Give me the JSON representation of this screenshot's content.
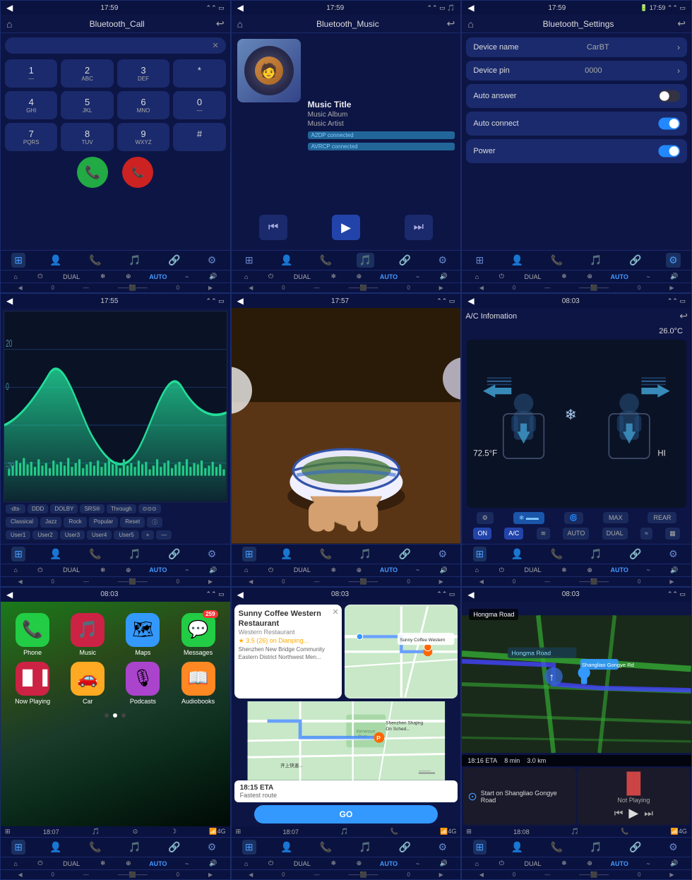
{
  "panels": [
    {
      "id": "bluetooth-call",
      "statusBar": {
        "time": "17:59",
        "back": "◀"
      },
      "titleBar": {
        "title": "Bluetooth_Call",
        "home": "⌂",
        "back": "↩"
      },
      "searchPlaceholder": "",
      "keypad": [
        {
          "label": "1",
          "sub": "—"
        },
        {
          "label": "2",
          "sub": "ABC"
        },
        {
          "label": "3",
          "sub": "DEF"
        },
        {
          "label": "*",
          "sub": ""
        },
        {
          "label": "4",
          "sub": "GHI"
        },
        {
          "label": "5",
          "sub": "JKL"
        },
        {
          "label": "6",
          "sub": "MNO"
        },
        {
          "label": "0",
          "sub": "—"
        },
        {
          "label": "7",
          "sub": "PQRS"
        },
        {
          "label": "8",
          "sub": "TUV"
        },
        {
          "label": "9",
          "sub": "WXYZ"
        },
        {
          "label": "#",
          "sub": ""
        }
      ],
      "navTabs": [
        "⊞",
        "👤",
        "📞",
        "🎵",
        "🔗",
        "⚙"
      ],
      "activeTab": 0
    },
    {
      "id": "bluetooth-music",
      "statusBar": {
        "time": "17:59",
        "back": "◀"
      },
      "titleBar": {
        "title": "Bluetooth_Music",
        "home": "⌂",
        "back": "↩"
      },
      "music": {
        "title": "Music Title",
        "album": "Music Album",
        "artist": "Music Artist",
        "badge1": "A2DP connected",
        "badge2": "AVRCP connected"
      },
      "navTabs": [
        "⊞",
        "👤",
        "📞",
        "🎵",
        "🔗",
        "⚙"
      ],
      "activeTab": 3
    },
    {
      "id": "bluetooth-settings",
      "statusBar": {
        "time": "17:59",
        "back": "◀"
      },
      "titleBar": {
        "title": "Bluetooth_Settings",
        "home": "⌂",
        "back": "↩"
      },
      "settings": [
        {
          "label": "Device name",
          "value": "CarBT",
          "type": "arrow"
        },
        {
          "label": "Device pin",
          "value": "0000",
          "type": "arrow"
        },
        {
          "label": "Auto answer",
          "value": "",
          "type": "toggle",
          "state": "off"
        },
        {
          "label": "Auto connect",
          "value": "",
          "type": "toggle",
          "state": "on"
        },
        {
          "label": "Power",
          "value": "",
          "type": "toggle",
          "state": "on"
        }
      ],
      "navTabs": [
        "⊞",
        "👤",
        "📞",
        "🎵",
        "🔗",
        "⚙"
      ],
      "activeTab": 5
    },
    {
      "id": "equalizer",
      "statusBar": {
        "time": "17:55",
        "back": "◀"
      },
      "titleBar": {
        "title": "",
        "home": "⌂",
        "back": ""
      },
      "eqButtons": [
        "dts",
        "DDD",
        "DOLBY",
        "SRS®",
        "Through",
        "OOO"
      ],
      "presets": [
        "Classical",
        "Jazz",
        "Rock",
        "Popular",
        "Reset",
        "ⓘ",
        "User1",
        "User2",
        "User3",
        "User4",
        "User5",
        "+",
        "—"
      ],
      "navTabs": [
        "⊞",
        "👤",
        "📞",
        "🎵",
        "🔗",
        "⚙"
      ],
      "activeTab": 0
    },
    {
      "id": "video",
      "statusBar": {
        "time": "17:57",
        "back": "◀"
      },
      "titleBar": {
        "title": "",
        "home": "⌂",
        "back": ""
      },
      "navTabs": [
        "⊞",
        "👤",
        "📞",
        "🎵",
        "🔗",
        "⚙"
      ],
      "activeTab": 0
    },
    {
      "id": "ac-info",
      "statusBar": {
        "time": "08:03",
        "back": "◀"
      },
      "acInfo": {
        "title": "A/C Infomation",
        "temp": "26.0°C",
        "leftTemp": "72.5°F",
        "fan": "HI"
      },
      "acButtons1": [
        "⚙",
        "❄",
        "",
        "🌀",
        "MAX",
        "REAR"
      ],
      "acButtons2": [
        "ON",
        "A/C",
        "≋",
        "AUTO",
        "DUAL",
        "≈",
        "▦"
      ],
      "navTabs": [
        "⊞",
        "👤",
        "📞",
        "🎵",
        "🔗",
        "⚙"
      ],
      "activeTab": 0
    },
    {
      "id": "carplay",
      "statusBar": {
        "time": "08:03",
        "back": "◀"
      },
      "apps": [
        {
          "name": "Phone",
          "icon": "📞",
          "color": "#22cc44",
          "badge": null
        },
        {
          "name": "Music",
          "icon": "🎵",
          "color": "#cc2244",
          "badge": null
        },
        {
          "name": "Maps",
          "icon": "🗺",
          "color": "#3399ff",
          "badge": null
        },
        {
          "name": "Messages",
          "icon": "💬",
          "color": "#22cc44",
          "badge": "259"
        },
        {
          "name": "Now Playing",
          "icon": "▐▌",
          "color": "#cc2244",
          "badge": null
        },
        {
          "name": "Car",
          "icon": "🚗",
          "color": "#ffaa22",
          "badge": null
        },
        {
          "name": "Podcasts",
          "icon": "🎙",
          "color": "#aa44cc",
          "badge": null
        },
        {
          "name": "Audiobooks",
          "icon": "📖",
          "color": "#ff8822",
          "badge": null
        }
      ],
      "dots": [
        false,
        true,
        false
      ],
      "statusbarTime": "18:07",
      "navTabs": [
        "⊞",
        "👤",
        "📞",
        "🎵",
        "🔗",
        "⚙"
      ],
      "activeTab": 0
    },
    {
      "id": "navigation",
      "statusBar": {
        "time": "08:03",
        "back": "◀"
      },
      "place": {
        "name": "Sunny Coffee Western Restaurant",
        "type": "Western Restaurant",
        "rating": "3.5",
        "reviews": "26",
        "source": "Dianping",
        "address": "Shenzhen New Bridge Community Eastern District Northwest Men..."
      },
      "eta": "18:15 ETA",
      "etaNote": "Fastest route",
      "goLabel": "GO",
      "statusbarTime": "18:07",
      "navTabs": [
        "⊞",
        "👤",
        "📞",
        "🎵",
        "🔗",
        "⚙"
      ],
      "activeTab": 0
    },
    {
      "id": "navigation2",
      "statusBar": {
        "time": "08:03",
        "back": "◀"
      },
      "roadName": "Hongma Road",
      "turnRoad": "Shangliao Gongye Road",
      "eta": "18:16 ETA",
      "etaMin": "8 min",
      "etaDist": "3.0 km",
      "startRoad": "Start on Shangliao Gongye Road",
      "notPlaying": "Not Playing",
      "statusbarTime": "18:08",
      "navTabs": [
        "⊞",
        "👤",
        "📞",
        "🎵",
        "🔗",
        "⚙"
      ],
      "activeTab": 0
    }
  ],
  "climateBar": {
    "power": "⏻",
    "dual": "DUAL",
    "ac": "❄",
    "fan": "⊕",
    "auto": "AUTO",
    "wind": "~",
    "vol": "🔊"
  },
  "icons": {
    "chevron": "›",
    "back": "↩",
    "home": "⌂",
    "skip_prev": "⏮",
    "play": "▶",
    "skip_next": "⏭",
    "pause": "⏸"
  }
}
